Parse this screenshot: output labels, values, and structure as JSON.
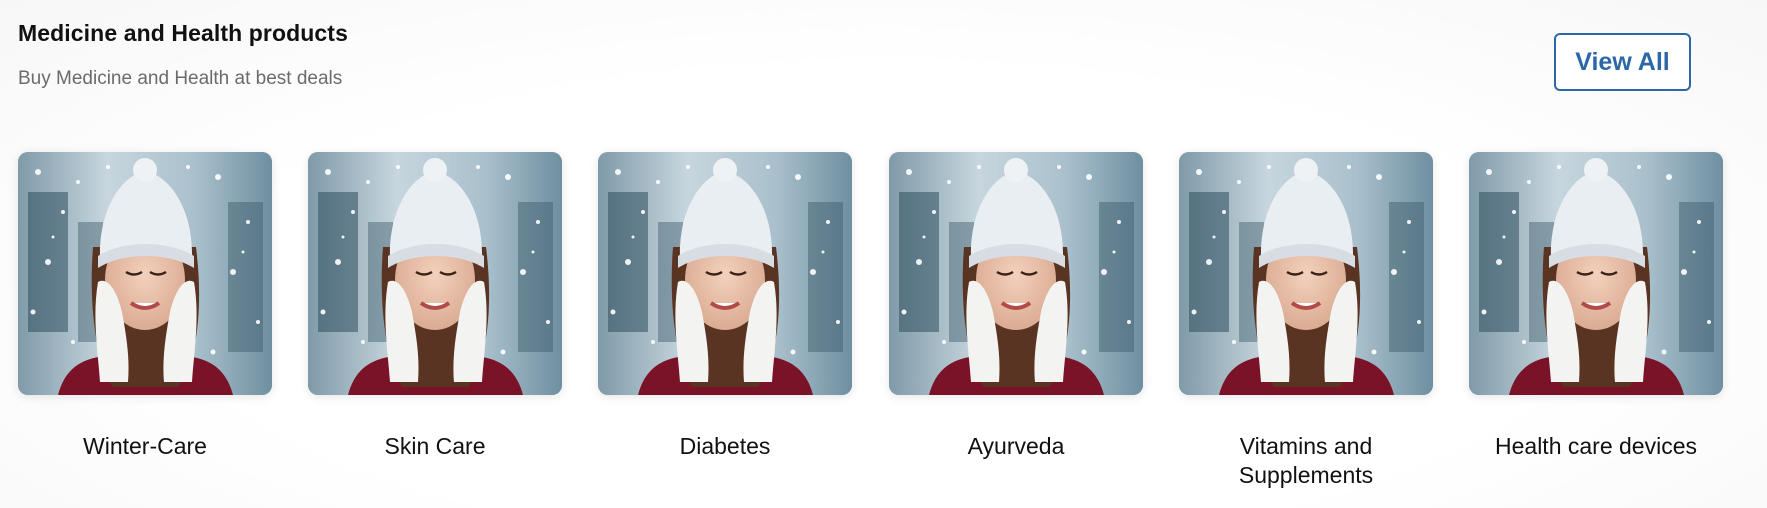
{
  "section": {
    "title": "Medicine and Health products",
    "subtitle": "Buy Medicine and Health at best deals",
    "view_all_label": "View All"
  },
  "categories": [
    {
      "label": "Winter-Care",
      "image": "woman-in-winter-hat-photo"
    },
    {
      "label": "Skin Care",
      "image": "woman-in-winter-hat-photo"
    },
    {
      "label": "Diabetes",
      "image": "woman-in-winter-hat-photo"
    },
    {
      "label": "Ayurveda",
      "image": "woman-in-winter-hat-photo"
    },
    {
      "label": "Vitamins and Supplements",
      "image": "woman-in-winter-hat-photo"
    },
    {
      "label": "Health care devices",
      "image": "woman-in-winter-hat-photo"
    }
  ],
  "colors": {
    "accent": "#2c67a8",
    "subtitle": "#6b6b6b"
  }
}
